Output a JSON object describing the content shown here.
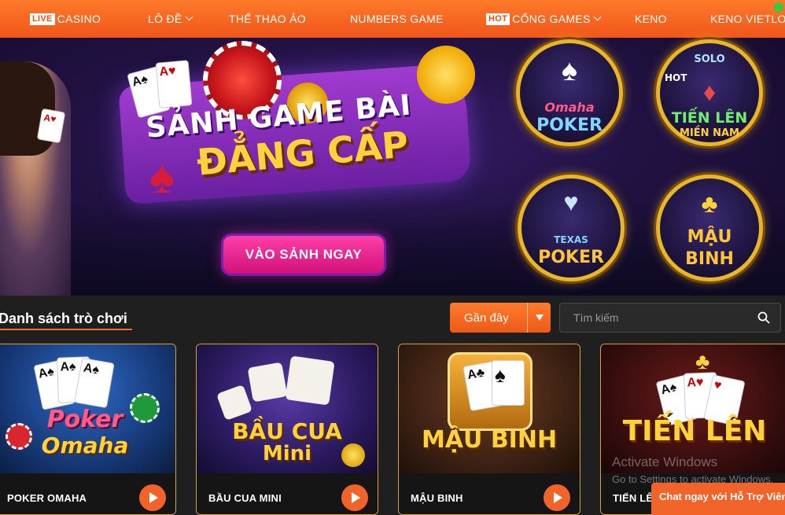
{
  "nav": {
    "items": [
      {
        "badge": "LIVE",
        "label": "CASINO",
        "chevron": false
      },
      {
        "badge": "",
        "label": "LÔ ĐỀ",
        "chevron": true
      },
      {
        "badge": "",
        "label": "THỂ THAO ẢO",
        "chevron": false
      },
      {
        "badge": "",
        "label": "NUMBERS GAME",
        "chevron": false
      },
      {
        "badge": "HOT",
        "label": "CỔNG GAMES",
        "chevron": true
      },
      {
        "badge": "",
        "label": "KENO",
        "chevron": false
      },
      {
        "badge": "",
        "label": "KENO VIETLOTT",
        "chevron": false
      }
    ]
  },
  "hero": {
    "title_line1": "SẢNH GAME BÀI",
    "title_line2": "ĐẲNG CẤP",
    "cta": "VÀO SẢNH NGAY",
    "badges": [
      {
        "top": "Omaha",
        "bottom": "POKER",
        "icon": "♠"
      },
      {
        "top": "HOT",
        "bottom": "TIẾN LÊN",
        "sub": "MIỀN NAM",
        "tag": "SOLO",
        "icon": "♦"
      },
      {
        "top": "TEXAS",
        "bottom": "POKER",
        "icon": "♥"
      },
      {
        "top": "MẬU",
        "bottom": "BINH",
        "icon": "♣"
      }
    ]
  },
  "games_section": {
    "title": "Danh sách trò chơi",
    "sort": {
      "selected": "Gần đây"
    },
    "search": {
      "placeholder": "Tìm kiếm"
    }
  },
  "games": [
    {
      "name": "POKER OMAHA",
      "art_line1": "Poker",
      "art_line2": "Omaha"
    },
    {
      "name": "BẦU CUA MINI",
      "art_line1": "BẦU CUA",
      "art_line2": "Mini"
    },
    {
      "name": "MẬU BINH",
      "art_line1": "MẬU BINH",
      "art_line2": ""
    },
    {
      "name": "TIẾN LÊN",
      "art_line1": "TIẾN LÊN",
      "art_line2": ""
    }
  ],
  "overlay": {
    "activate_title": "Activate Windows",
    "activate_sub": "Go to Settings to activate Windows.",
    "chat": "Chat ngay với Hỗ Trợ Viên"
  },
  "colors": {
    "accent": "#f2632a",
    "card_border": "#d9a22a",
    "cta": "#e0208a"
  }
}
